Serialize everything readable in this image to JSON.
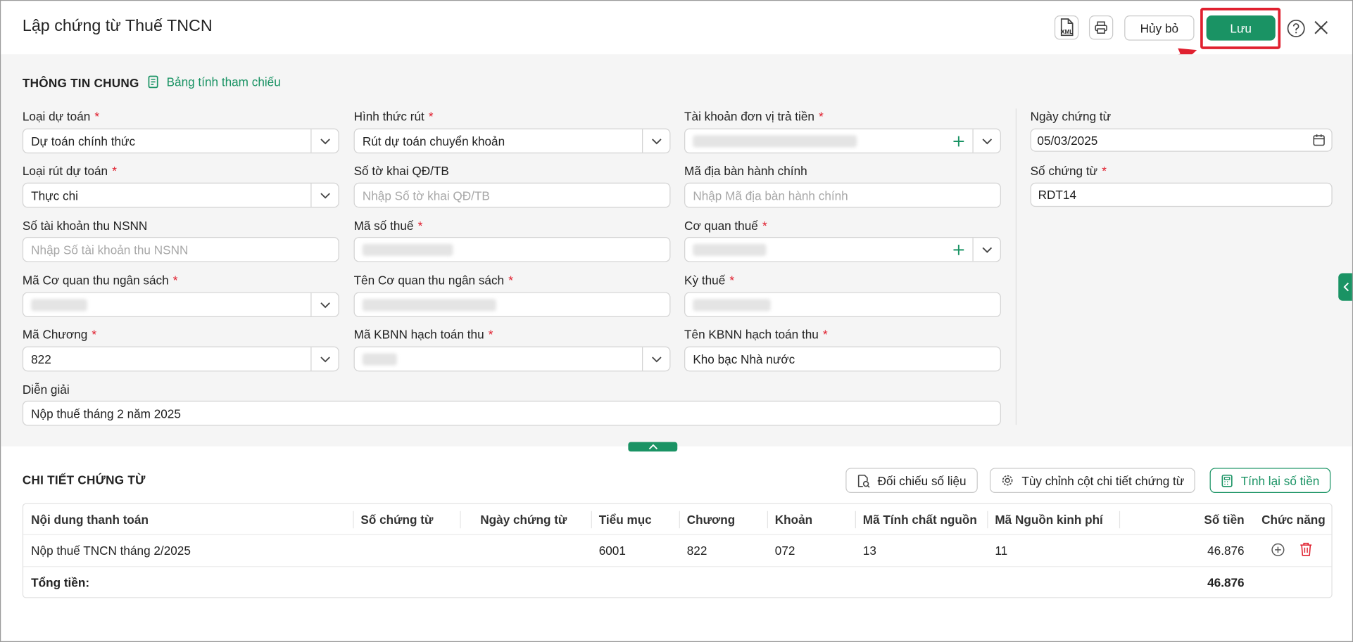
{
  "dialog": {
    "title": "Lập chứng từ Thuế TNCN",
    "xml_label": "XML",
    "cancel_label": "Hủy bỏ",
    "save_label": "Lưu"
  },
  "general": {
    "section_title": "THÔNG TIN CHUNG",
    "reference_link": "Bảng tính tham chiếu"
  },
  "fields": {
    "loai_du_toan": {
      "label": "Loại dự toán",
      "value": "Dự toán chính thức"
    },
    "hinh_thuc_rut": {
      "label": "Hình thức rút",
      "value": "Rút dự toán chuyển khoản"
    },
    "tai_khoan_don_vi": {
      "label": "Tài khoản đơn vị trả tiền"
    },
    "ngay_chung_tu": {
      "label": "Ngày chứng từ",
      "value": "05/03/2025"
    },
    "loai_rut_du_toan": {
      "label": "Loại rút dự toán",
      "value": "Thực chi"
    },
    "so_to_khai": {
      "label": "Số tờ khai QĐ/TB",
      "placeholder": "Nhập Số tờ khai QĐ/TB"
    },
    "ma_dia_ban": {
      "label": "Mã địa bàn hành chính",
      "placeholder": "Nhập Mã địa bàn hành chính"
    },
    "so_chung_tu": {
      "label": "Số chứng từ",
      "value": "RDT14"
    },
    "so_tai_khoan_thu": {
      "label": "Số tài khoản thu NSNN",
      "placeholder": "Nhập Số tài khoản thu NSNN"
    },
    "ma_so_thue": {
      "label": "Mã số thuế"
    },
    "co_quan_thue": {
      "label": "Cơ quan thuế"
    },
    "ma_co_quan_thu": {
      "label": "Mã Cơ quan thu ngân sách"
    },
    "ten_co_quan_thu": {
      "label": "Tên Cơ quan thu ngân sách"
    },
    "ky_thue": {
      "label": "Kỳ thuế"
    },
    "ma_chuong": {
      "label": "Mã Chương",
      "value": "822"
    },
    "ma_kbnn": {
      "label": "Mã KBNN hạch toán thu"
    },
    "ten_kbnn": {
      "label": "Tên KBNN hạch toán thu",
      "value": "Kho bạc Nhà nước"
    },
    "dien_giai": {
      "label": "Diễn giải",
      "value": "Nộp thuế tháng 2 năm 2025"
    }
  },
  "detail": {
    "section_title": "CHI TIẾT CHỨNG TỪ",
    "compare_label": "Đối chiếu số liệu",
    "customize_label": "Tùy chỉnh cột chi tiết chứng từ",
    "recalc_label": "Tính lại số tiền"
  },
  "table": {
    "headers": {
      "noi_dung": "Nội dung thanh toán",
      "so_ct": "Số chứng từ",
      "ngay_ct": "Ngày chứng từ",
      "tieu_muc": "Tiểu mục",
      "chuong": "Chương",
      "khoan": "Khoản",
      "ma_tcn": "Mã Tính chất nguồn",
      "ma_nkp": "Mã Nguồn kinh phí",
      "so_tien": "Số tiền",
      "chuc_nang": "Chức năng"
    },
    "rows": [
      {
        "noi_dung": "Nộp thuế TNCN tháng 2/2025",
        "so_ct": "",
        "ngay_ct": "",
        "tieu_muc": "6001",
        "chuong": "822",
        "khoan": "072",
        "ma_tcn": "13",
        "ma_nkp": "11",
        "so_tien": "46.876"
      }
    ],
    "total_label": "Tổng tiền:",
    "total_value": "46.876"
  },
  "colors": {
    "accent": "#1a9364",
    "required": "#e0202f",
    "highlight": "#e0202f"
  }
}
